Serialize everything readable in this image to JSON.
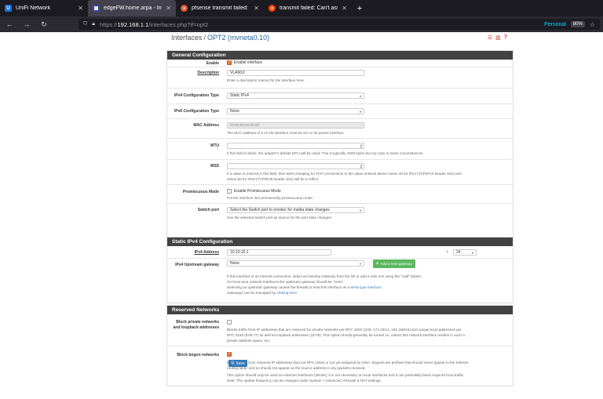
{
  "browser": {
    "tabs": [
      {
        "title": "UniFi Network",
        "icon": "unifi-icon",
        "color": "#1e6fd9",
        "glyph": "U"
      },
      {
        "title": "edgeFW.home.arpa - Inte",
        "icon": "pfsense-icon",
        "color": "#3b4b9b",
        "glyph": "▣"
      },
      {
        "title": "pfsense transmit failed:",
        "icon": "duckduckgo-icon",
        "color": "#de5833",
        "glyph": "●"
      },
      {
        "title": "transmit failed: Can't ass",
        "icon": "reddit-icon",
        "color": "#ff4500",
        "glyph": "●"
      }
    ],
    "url_prefix": "https://",
    "url_host": "192.168.1.1",
    "url_path": "/interfaces.php?if=opt2",
    "profile": "Personal",
    "zoom": "80%"
  },
  "breadcrumb": {
    "root": "Interfaces",
    "sep": "/",
    "current": "OPT2 (mvneta0.10)"
  },
  "general": {
    "heading": "General Configuration",
    "enable_label": "Enable",
    "enable_text": "Enable interface",
    "enable_checked": true,
    "description_label": "Description",
    "description_value": "VLAN10",
    "description_help": "Enter a description (name) for the interface here.",
    "ipv4_type_label": "IPv4 Configuration Type",
    "ipv4_type_value": "Static IPv4",
    "ipv6_type_label": "IPv6 Configuration Type",
    "ipv6_type_value": "None",
    "mac_label": "MAC Address",
    "mac_placeholder": "xx:xx:xx:xx:xx:xx",
    "mac_help": "The MAC address of a VLAN interface must be set on its parent interface",
    "mtu_label": "MTU",
    "mtu_help": "If this field is blank, the adapter's default MTU will be used. This is typically 1500 bytes but can vary in some circumstances.",
    "mss_label": "MSS",
    "mss_help_1": "If a value is entered in this field, then MSS clamping for TCP connections to the value entered above minus 40 for IPv4 (TCP/IPv4 header size) and",
    "mss_help_2": "minus 60 for IPv6 (TCP/IPv6 header size) will be in effect.",
    "promisc_label": "Promiscuous Mode",
    "promisc_text": "Enable Promiscuous Mode",
    "promisc_help": "Put the interface into permanently promiscuous mode.",
    "switch_label": "Switch port",
    "switch_value": "Select the Switch port to monitor for media state changes",
    "switch_help": "Use the selected Switch port as source for the port state changes."
  },
  "static_ipv4": {
    "heading": "Static IPv4 Configuration",
    "address_label": "IPv4 Address",
    "address_value": "10.10.10.1",
    "cidr_sep": "/",
    "cidr_value": "24",
    "gateway_label": "IPv4 Upstream gateway",
    "gateway_value": "None",
    "add_gateway": "Add a new gateway",
    "help_1": "If this interface is an Internet connection, select an existing Gateway from the list or add a new one using the \"Add\" button.",
    "help_2": "On local area network interfaces the upstream gateway should be \"none\".",
    "help_3a": "Selecting an upstream gateway causes the firewall to treat this interface as a ",
    "help_3_link": "WAN type interface",
    "help_3b": ".",
    "help_4a": "Gateways can be managed by ",
    "help_4_link": "clicking here",
    "help_4b": "."
  },
  "reserved": {
    "heading": "Reserved Networks",
    "private_label_1": "Block private networks",
    "private_label_2": "and loopback addresses",
    "private_checked": false,
    "private_help_1": "Blocks traffic from IP addresses that are reserved for private networks per RFC 1918 (10/8, 172.16/12, 192.168/16) and unique local addresses per",
    "private_help_2": "RFC 4193 (fc00::/7) as well as loopback addresses (127/8). This option should generally be turned on, unless this network interface resides in such a",
    "private_help_3": "private address space, too.",
    "bogon_label": "Block bogon networks",
    "bogon_checked": true,
    "bogon_help_1": "Blocks traffic from reserved IP addresses (but not RFC 1918) or not yet assigned by IANA. Bogons are prefixes that should never appear in the Internet",
    "bogon_help_2": "routing table, and so should not appear as the source address in any packets received.",
    "bogon_help_3": "This option should only be used on external interfaces (WANs), it is not necessary on local interfaces and it can potentially block required local traffic.",
    "bogon_help_4": "Note: The update frequency can be changed under System > Advanced, Firewall & NAT settings."
  },
  "save_label": "Save"
}
